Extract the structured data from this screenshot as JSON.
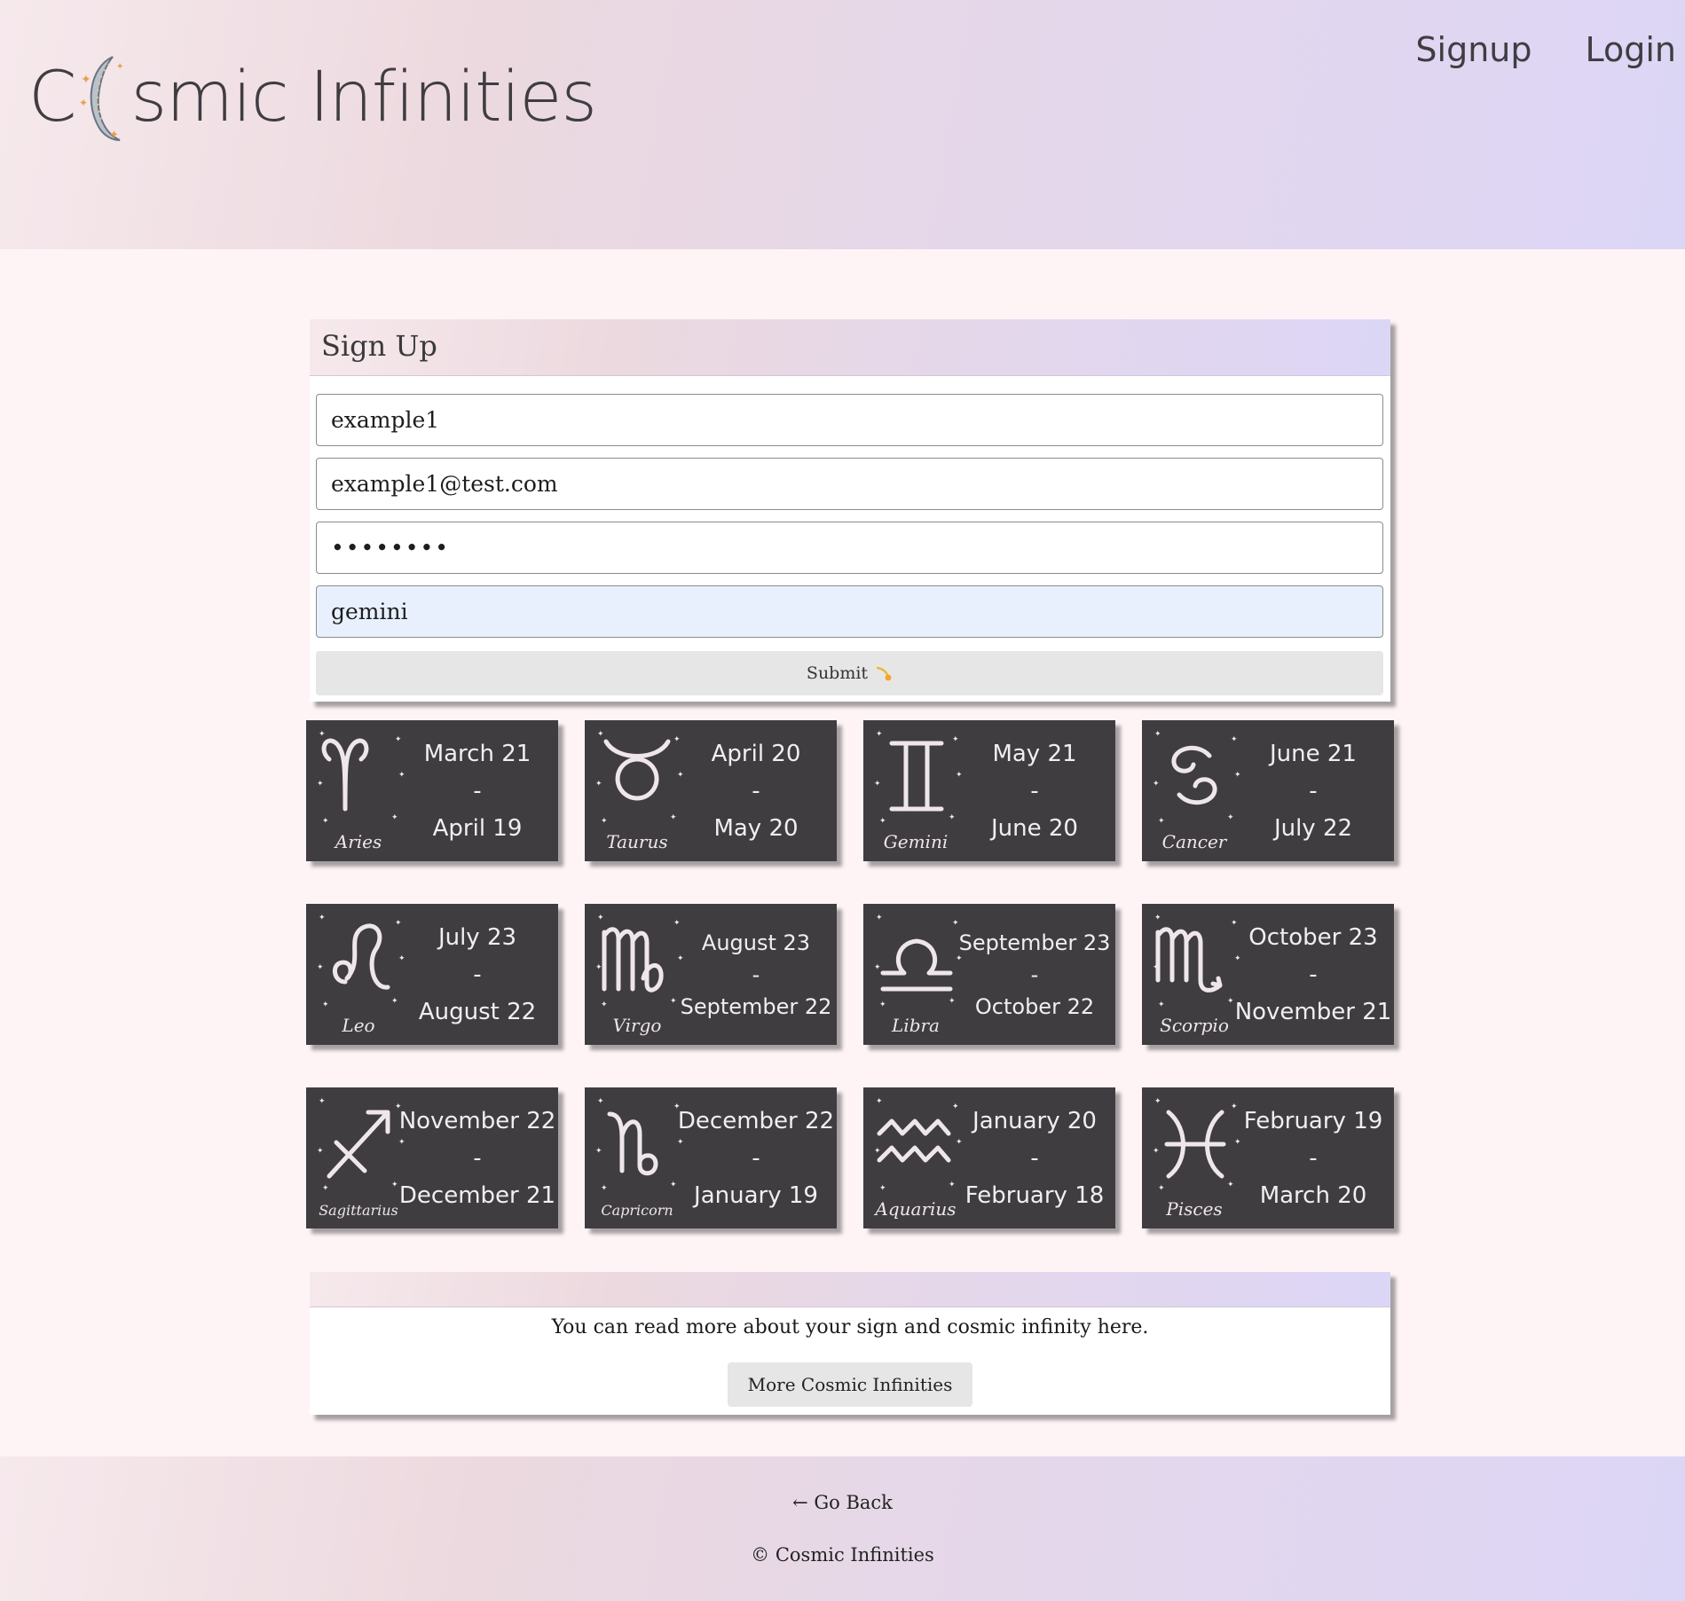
{
  "brand": {
    "title_prefix": "C",
    "title_suffix": "smic Infinities"
  },
  "nav": {
    "signup": "Signup",
    "login": "Login"
  },
  "signup_form": {
    "heading": "Sign Up",
    "username_value": "example1",
    "email_value": "example1@test.com",
    "password_mask": "••••••••",
    "sign_value": "gemini",
    "submit_label": "Submit",
    "submit_icon": "shooting-star-icon"
  },
  "zodiac": [
    {
      "name": "Aries",
      "start": "March 21",
      "sep": "-",
      "end": "April 19"
    },
    {
      "name": "Taurus",
      "start": "April 20",
      "sep": "-",
      "end": "May 20"
    },
    {
      "name": "Gemini",
      "start": "May 21",
      "sep": "-",
      "end": "June 20"
    },
    {
      "name": "Cancer",
      "start": "June 21",
      "sep": "-",
      "end": "July 22"
    },
    {
      "name": "Leo",
      "start": "July 23",
      "sep": "-",
      "end": "August 22"
    },
    {
      "name": "Virgo",
      "start": "August 23",
      "sep": "-",
      "end": "September 22"
    },
    {
      "name": "Libra",
      "start": "September 23",
      "sep": "-",
      "end": "October 22"
    },
    {
      "name": "Scorpio",
      "start": "October 23",
      "sep": "-",
      "end": "November 21"
    },
    {
      "name": "Sagittarius",
      "start": "November 22",
      "sep": "-",
      "end": "December 21"
    },
    {
      "name": "Capricorn",
      "start": "December 22",
      "sep": "-",
      "end": "January 19"
    },
    {
      "name": "Aquarius",
      "start": "January 20",
      "sep": "-",
      "end": "February 18"
    },
    {
      "name": "Pisces",
      "start": "February 19",
      "sep": "-",
      "end": "March 20"
    }
  ],
  "info": {
    "text": "You can read more about your sign and cosmic infinity here.",
    "button": "More Cosmic Infinities"
  },
  "footer": {
    "back": "← Go Back",
    "copyright_symbol": "©",
    "copyright_name": "Cosmic Infinities"
  }
}
